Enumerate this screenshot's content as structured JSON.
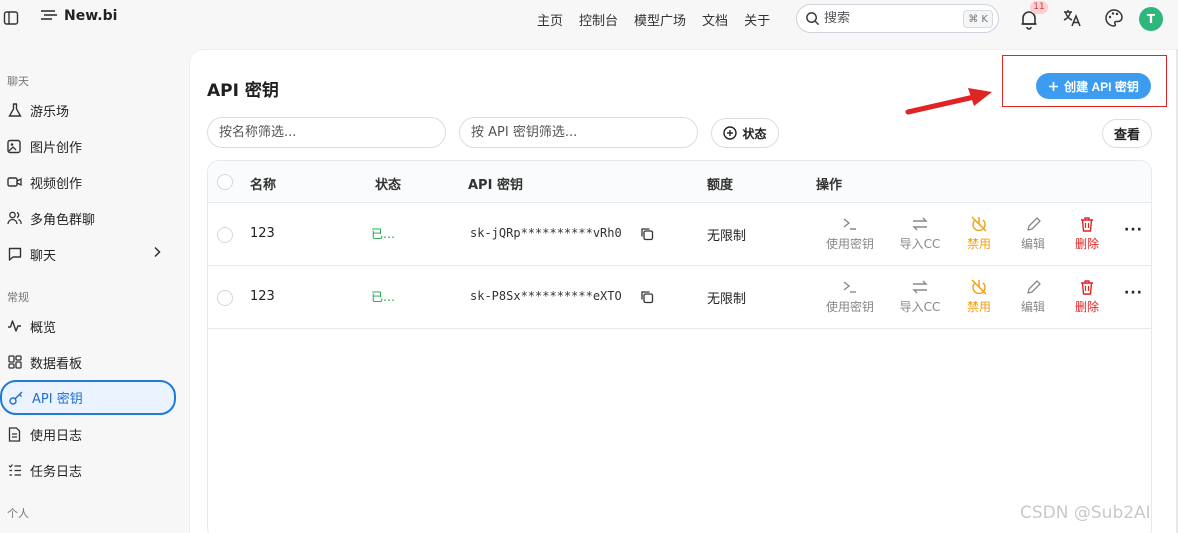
{
  "app": {
    "logo_text": "New.bi"
  },
  "nav": {
    "items": [
      "主页",
      "控制台",
      "模型广场",
      "文档",
      "关于"
    ]
  },
  "search": {
    "placeholder": "搜索",
    "shortcut": "⌘ K"
  },
  "notifications": {
    "count": "11"
  },
  "user": {
    "avatar_initial": "T"
  },
  "sidebar": {
    "sections": [
      {
        "label": "聊天",
        "items": [
          "游乐场",
          "图片创作",
          "视频创作",
          "多角色群聊",
          "聊天"
        ]
      },
      {
        "label": "常规",
        "items": [
          "概览",
          "数据看板",
          "API 密钥",
          "使用日志",
          "任务日志"
        ]
      },
      {
        "label": "个人",
        "items": []
      }
    ],
    "active": "API 密钥"
  },
  "page": {
    "title": "API 密钥",
    "create_label": "创建 API 密钥",
    "filter_name_placeholder": "按名称筛选...",
    "filter_key_placeholder": "按 API 密钥筛选...",
    "status_filter_label": "状态",
    "view_label": "查看"
  },
  "table": {
    "columns": [
      "名称",
      "状态",
      "API 密钥",
      "额度",
      "操作"
    ],
    "rows": [
      {
        "name": "123",
        "status": "已…",
        "key": "sk-jQRp**********vRh0",
        "quota": "无限制"
      },
      {
        "name": "123",
        "status": "已…",
        "key": "sk-P8Sx**********eXTO",
        "quota": "无限制"
      }
    ],
    "actions": [
      "使用密钥",
      "导入CC",
      "禁用",
      "编辑",
      "删除"
    ]
  },
  "watermark": "CSDN @Sub2AI",
  "colors": {
    "accent": "#3d9bf0",
    "active_border": "#1f7ad8",
    "status_green": "#16a34a",
    "disable_orange": "#f59e0b",
    "delete_red": "#e02424"
  }
}
